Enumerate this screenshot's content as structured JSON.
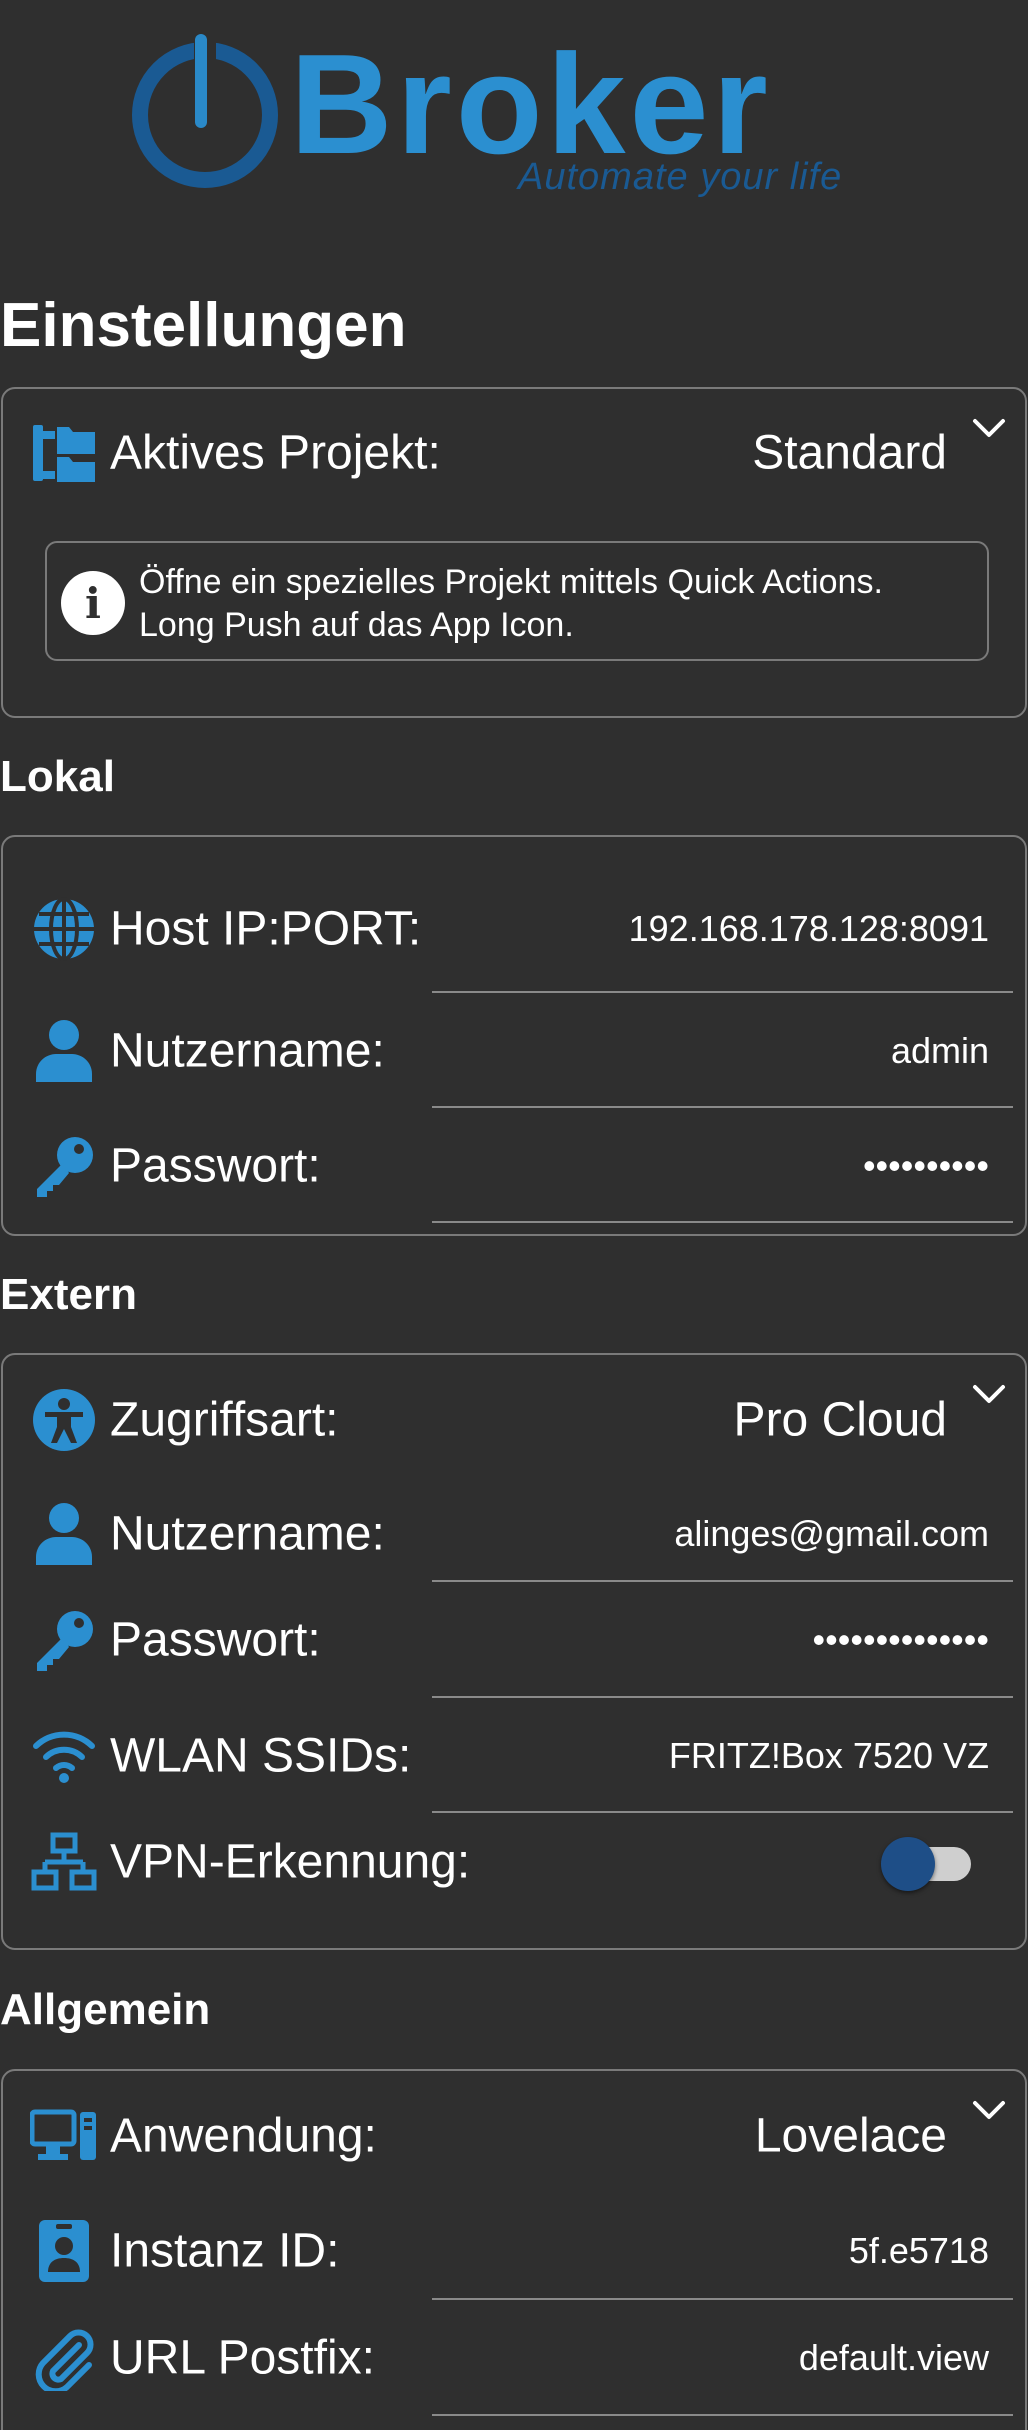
{
  "logo": {
    "brand": "iBroker",
    "word": "Broker",
    "tagline": "Automate your life"
  },
  "page_title": "Einstellungen",
  "project": {
    "label": "Aktives Projekt:",
    "value": "Standard",
    "info_line1": "Öffne ein spezielles Projekt mittels Quick Actions.",
    "info_line2": "Long Push auf das App Icon."
  },
  "lokal": {
    "title": "Lokal",
    "host_label": "Host IP:PORT:",
    "host_value": "192.168.178.128:8091",
    "user_label": "Nutzername:",
    "user_value": "admin",
    "pass_label": "Passwort:",
    "pass_value": "••••••••••"
  },
  "extern": {
    "title": "Extern",
    "access_label": "Zugriffsart:",
    "access_value": "Pro Cloud",
    "user_label": "Nutzername:",
    "user_value": "alinges@gmail.com",
    "pass_label": "Passwort:",
    "pass_value": "••••••••••••••",
    "ssid_label": "WLAN SSIDs:",
    "ssid_value": "FRITZ!Box 7520 VZ",
    "vpn_label": "VPN-Erkennung:",
    "vpn_enabled": false
  },
  "allgemein": {
    "title": "Allgemein",
    "app_label": "Anwendung:",
    "app_value": "Lovelace",
    "instance_label": "Instanz ID:",
    "instance_value": "5f.e5718",
    "postfix_label": "URL Postfix:",
    "postfix_value": "default.view"
  },
  "colors": {
    "background": "#2f2f2f",
    "accent": "#2b8fd0",
    "accent_dark": "#1a5a93",
    "border": "#7a7a7a"
  }
}
